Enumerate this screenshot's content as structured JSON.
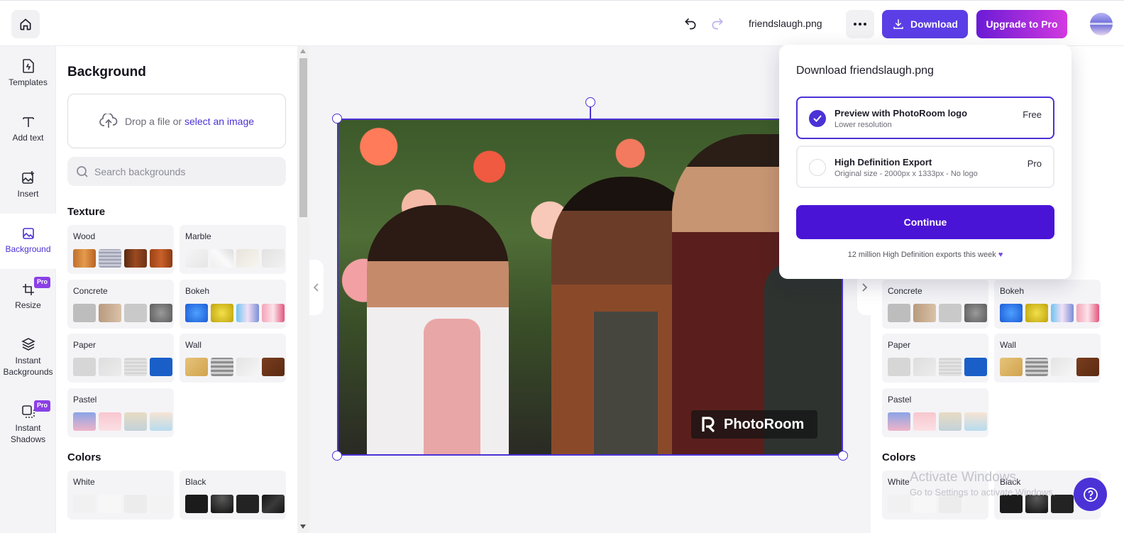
{
  "header": {
    "filename": "friendslaugh.png",
    "download_label": "Download",
    "upgrade_label": "Upgrade to Pro"
  },
  "rail": {
    "items": [
      {
        "label": "Templates",
        "icon": "templates-icon"
      },
      {
        "label": "Add text",
        "icon": "text-icon"
      },
      {
        "label": "Insert",
        "icon": "insert-image-icon"
      },
      {
        "label": "Background",
        "icon": "background-icon",
        "active": true
      },
      {
        "label": "Resize",
        "icon": "resize-icon",
        "badge": "Pro"
      },
      {
        "label": "Instant Backgrounds",
        "icon": "layers-icon"
      },
      {
        "label": "Instant Shadows",
        "icon": "shadow-icon",
        "badge": "Pro"
      }
    ]
  },
  "panel": {
    "title": "Background",
    "drop_text": "Drop a file or ",
    "drop_link": "select an image",
    "search_placeholder": "Search backgrounds",
    "texture_title": "Texture",
    "colors_title": "Colors",
    "tiles": [
      {
        "label": "Wood"
      },
      {
        "label": "Marble"
      },
      {
        "label": "Concrete"
      },
      {
        "label": "Bokeh"
      },
      {
        "label": "Paper"
      },
      {
        "label": "Wall"
      },
      {
        "label": "Pastel"
      },
      {
        "label": "White"
      },
      {
        "label": "Black"
      }
    ]
  },
  "canvas": {
    "watermark_text": "PhotoRoom"
  },
  "popover": {
    "title": "Download friendslaugh.png",
    "options": [
      {
        "name": "Preview with PhotoRoom logo",
        "desc": "Lower resolution",
        "tag": "Free",
        "selected": true
      },
      {
        "name": "High Definition Export",
        "desc": "Original size - 2000px x 1333px - No logo",
        "tag": "Pro",
        "selected": false
      }
    ],
    "continue_label": "Continue",
    "note": "12 million High Definition exports this week"
  },
  "overlay": {
    "activate_title": "Activate Windows",
    "activate_sub": "Go to Settings to activate Windows."
  },
  "colors": {
    "accent": "#4a32d6",
    "download_button": "#5b3ee6",
    "upgrade_gradient_start": "#6a1bd6",
    "upgrade_gradient_end": "#d33ae0",
    "continue_button": "#4a14d6"
  }
}
